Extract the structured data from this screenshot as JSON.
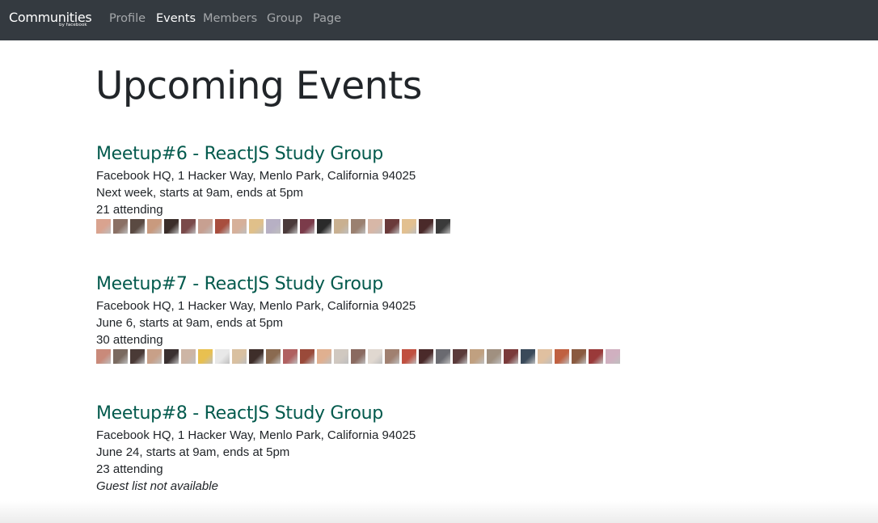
{
  "nav": {
    "brand": "Communities",
    "brand_sub": "by facebook",
    "items": [
      {
        "label": "Profile",
        "active": false
      },
      {
        "label": "Events",
        "active": true
      },
      {
        "label": "Members",
        "active": false
      },
      {
        "label": "Group",
        "active": false
      },
      {
        "label": "Page",
        "active": false
      }
    ]
  },
  "page_title": "Upcoming Events",
  "events": [
    {
      "title": "Meetup#6 - ReactJS Study Group",
      "location": "Facebook HQ, 1 Hacker Way, Menlo Park, California 94025",
      "when": "Next week, starts at 9am, ends at 5pm",
      "attending": "21 attending",
      "avatar_colors": [
        "#d9a38f",
        "#8a7064",
        "#5a4a42",
        "#c99a7e",
        "#3b2e2a",
        "#7a4a4a",
        "#c7a091",
        "#a84e3e",
        "#d6b09a",
        "#e0c08a",
        "#b7b0c4",
        "#4a3a3a",
        "#7b3b4a",
        "#2a2a2a",
        "#c9b090",
        "#9a8070",
        "#d7b7a7",
        "#6a3a3a",
        "#e2c090",
        "#4a2a2a",
        "#3a3a3a"
      ]
    },
    {
      "title": "Meetup#7 - ReactJS Study Group",
      "location": "Facebook HQ, 1 Hacker Way, Menlo Park, California 94025",
      "when": "June 6, starts at 9am, ends at 5pm",
      "attending": "30 attending",
      "avatar_colors": [
        "#c98a7a",
        "#7a6a60",
        "#4a3a36",
        "#c8a088",
        "#3a3030",
        "#cdb5a5",
        "#e8c050",
        "#e8e8e8",
        "#d9c0a0",
        "#3e2e2a",
        "#8a6a50",
        "#b06060",
        "#9a4a3a",
        "#e0b090",
        "#d0c8c0",
        "#8a6a60",
        "#e0d8d0",
        "#a08070",
        "#c05040",
        "#4a2a2a",
        "#6a6a70",
        "#5a3a3a",
        "#c0a080",
        "#a09080",
        "#7a3a3a",
        "#3a4a5a",
        "#e0c0a0",
        "#c06040",
        "#8a5a40",
        "#9a3a3a",
        "#d0b0c0"
      ]
    },
    {
      "title": "Meetup#8 - ReactJS Study Group",
      "location": "Facebook HQ, 1 Hacker Way, Menlo Park, California 94025",
      "when": "June 24, starts at 9am, ends at 5pm",
      "attending": "23 attending",
      "guest_note": "Guest list not available"
    }
  ]
}
